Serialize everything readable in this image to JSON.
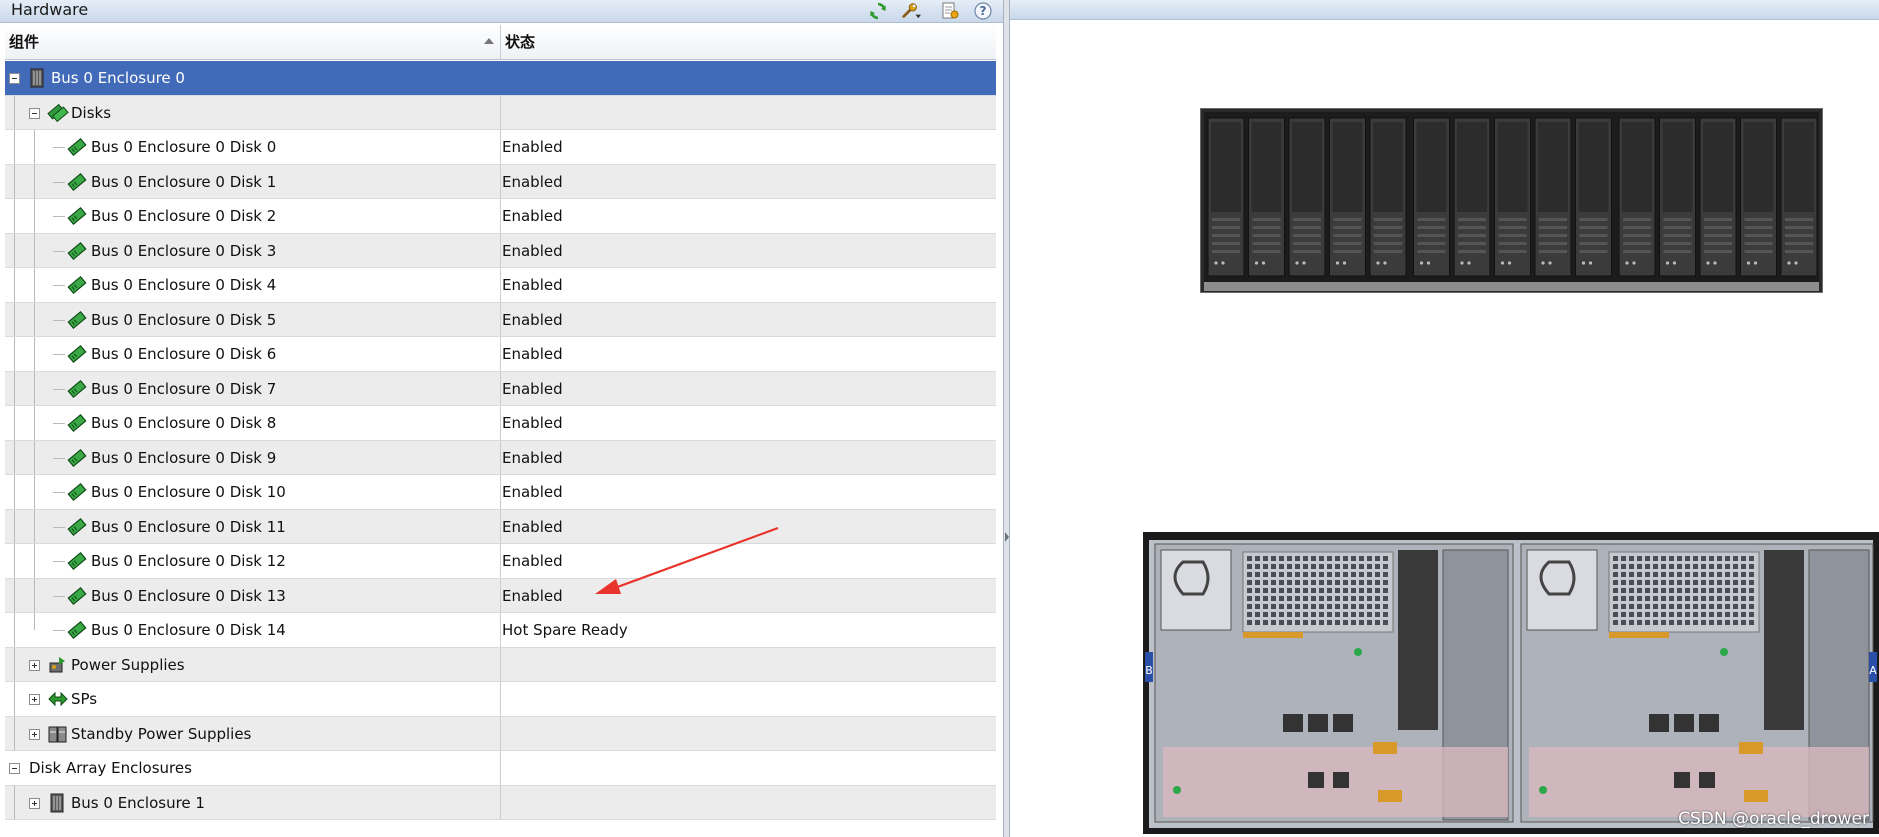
{
  "panel": {
    "title": "Hardware"
  },
  "toolbar": {
    "icons": [
      "refresh-icon",
      "wrench-icon",
      "properties-icon",
      "help-icon"
    ],
    "help_glyph": "?"
  },
  "table": {
    "columns": [
      "组件",
      "状态"
    ],
    "rows": [
      {
        "label": "Bus 0 Enclosure 0",
        "status": "",
        "selected": true,
        "icon": "enclosure-icon",
        "expander": "collapse"
      },
      {
        "label": "Disks",
        "status": "",
        "icon": "disks-group-icon",
        "expander": "collapse"
      },
      {
        "label": "Bus 0 Enclosure 0 Disk 0",
        "status": "Enabled",
        "icon": "disk-icon"
      },
      {
        "label": "Bus 0 Enclosure 0 Disk 1",
        "status": "Enabled",
        "icon": "disk-icon"
      },
      {
        "label": "Bus 0 Enclosure 0 Disk 2",
        "status": "Enabled",
        "icon": "disk-icon"
      },
      {
        "label": "Bus 0 Enclosure 0 Disk 3",
        "status": "Enabled",
        "icon": "disk-icon"
      },
      {
        "label": "Bus 0 Enclosure 0 Disk 4",
        "status": "Enabled",
        "icon": "disk-icon"
      },
      {
        "label": "Bus 0 Enclosure 0 Disk 5",
        "status": "Enabled",
        "icon": "disk-icon"
      },
      {
        "label": "Bus 0 Enclosure 0 Disk 6",
        "status": "Enabled",
        "icon": "disk-icon"
      },
      {
        "label": "Bus 0 Enclosure 0 Disk 7",
        "status": "Enabled",
        "icon": "disk-icon"
      },
      {
        "label": "Bus 0 Enclosure 0 Disk 8",
        "status": "Enabled",
        "icon": "disk-icon"
      },
      {
        "label": "Bus 0 Enclosure 0 Disk 9",
        "status": "Enabled",
        "icon": "disk-icon"
      },
      {
        "label": "Bus 0 Enclosure 0 Disk 10",
        "status": "Enabled",
        "icon": "disk-icon"
      },
      {
        "label": "Bus 0 Enclosure 0 Disk 11",
        "status": "Enabled",
        "icon": "disk-icon"
      },
      {
        "label": "Bus 0 Enclosure 0 Disk 12",
        "status": "Enabled",
        "icon": "disk-icon"
      },
      {
        "label": "Bus 0 Enclosure 0 Disk 13",
        "status": "Enabled",
        "icon": "disk-icon"
      },
      {
        "label": "Bus 0 Enclosure 0 Disk 14",
        "status": "Hot Spare Ready",
        "icon": "disk-icon"
      },
      {
        "label": "Power Supplies",
        "status": "",
        "icon": "power-supply-icon",
        "expander": "expand"
      },
      {
        "label": "SPs",
        "status": "",
        "icon": "storage-processor-icon",
        "expander": "expand"
      },
      {
        "label": "Standby Power Supplies",
        "status": "",
        "icon": "battery-icon",
        "expander": "expand"
      },
      {
        "label": "Disk Array Enclosures",
        "status": "",
        "expander": "collapse"
      },
      {
        "label": "Bus 0 Enclosure 1",
        "status": "",
        "icon": "enclosure-icon",
        "expander": "expand"
      }
    ]
  },
  "preview": {
    "front_image": "enclosure-front-view",
    "rear_image": "enclosure-rear-view",
    "rear_labels": [
      "B",
      "A"
    ]
  },
  "annotation": {
    "arrow_color": "#e8342b"
  },
  "colors": {
    "selection": "#416bb9",
    "header_bar": "#c9d8ea"
  },
  "watermark": "CSDN @oracle_drower"
}
